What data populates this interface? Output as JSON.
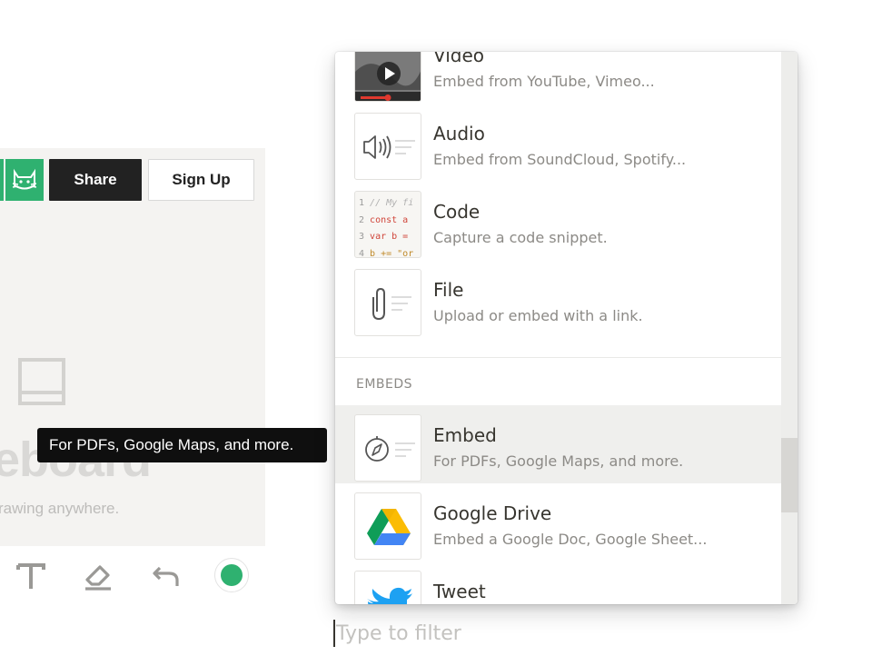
{
  "whiteboard": {
    "share_label": "Share",
    "signup_label": "Sign Up",
    "big_title": "eboard",
    "subtitle": "rawing anywhere.",
    "accent_color": "#2fb170"
  },
  "tooltip": {
    "text": "For PDFs, Google Maps, and more."
  },
  "menu": {
    "items_top": [
      {
        "title": "Video",
        "desc": "Embed from YouTube, Vimeo...",
        "icon": "video-thumbnail"
      },
      {
        "title": "Audio",
        "desc": "Embed from SoundCloud, Spotify...",
        "icon": "audio-icon"
      },
      {
        "title": "Code",
        "desc": "Capture a code snippet.",
        "icon": "code-thumbnail",
        "code": [
          "// My fi",
          "const a",
          "var b =",
          "b += \"or"
        ]
      },
      {
        "title": "File",
        "desc": "Upload or embed with a link.",
        "icon": "paperclip-icon"
      }
    ],
    "section_label": "EMBEDS",
    "items_embeds": [
      {
        "title": "Embed",
        "desc": "For PDFs, Google Maps, and more.",
        "icon": "compass-icon"
      },
      {
        "title": "Google Drive",
        "desc": "Embed a Google Doc, Google Sheet...",
        "icon": "google-drive-icon"
      },
      {
        "title": "Tweet",
        "desc": "",
        "icon": "twitter-icon"
      }
    ]
  },
  "filter": {
    "placeholder": "Type to filter"
  }
}
